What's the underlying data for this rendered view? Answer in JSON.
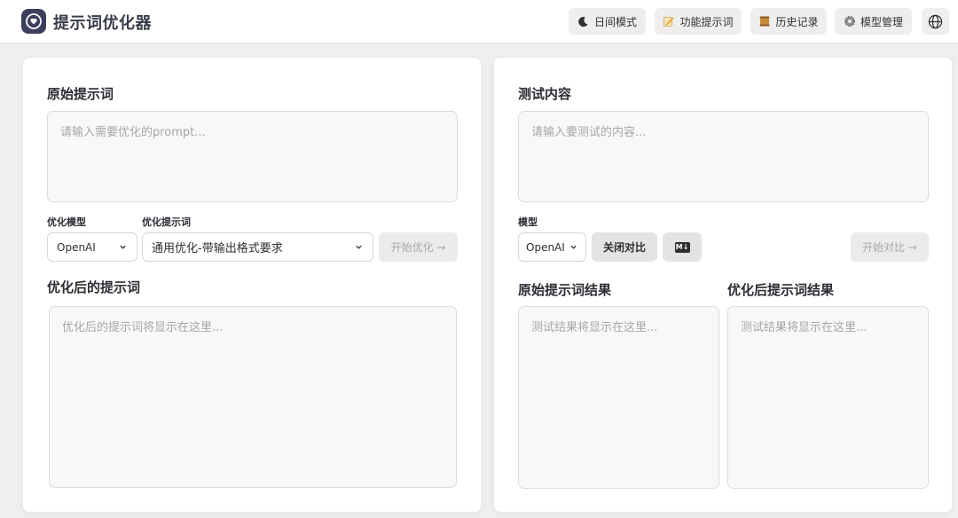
{
  "app": {
    "title": "提示词优化器"
  },
  "toolbar": {
    "theme_label": "日间模式",
    "feature_prompt_label": "功能提示词",
    "history_label": "历史记录",
    "model_manage_label": "模型管理",
    "icons": {
      "theme": "moon-icon",
      "feature_prompt": "memo-icon",
      "history": "scroll-icon",
      "model_manage": "gear-icon",
      "language": "globe-icon"
    }
  },
  "left": {
    "original_title": "原始提示词",
    "original_placeholder": "请输入需要优化的prompt...",
    "model_label": "优化模型",
    "model_value": "OpenAI",
    "template_label": "优化提示词",
    "template_value": "通用优化-带输出格式要求",
    "optimize_button": "开始优化 →",
    "optimized_title": "优化后的提示词",
    "optimized_placeholder": "优化后的提示词将显示在这里..."
  },
  "right": {
    "test_title": "测试内容",
    "test_placeholder": "请输入要测试的内容...",
    "model_label": "模型",
    "model_value": "OpenAI",
    "compare_toggle": "关闭对比",
    "markdown_badge": "M↓",
    "compare_button": "开始对比 →",
    "original_result_title": "原始提示词结果",
    "original_result_placeholder": "测试结果将显示在这里...",
    "optimized_result_title": "优化后提示词结果",
    "optimized_result_placeholder": "测试结果将显示在这里..."
  },
  "colors": {
    "background": "#f0efed",
    "panel": "#ffffff",
    "logo": "#3b3f5c",
    "disabled_text": "#a9a8a7"
  }
}
